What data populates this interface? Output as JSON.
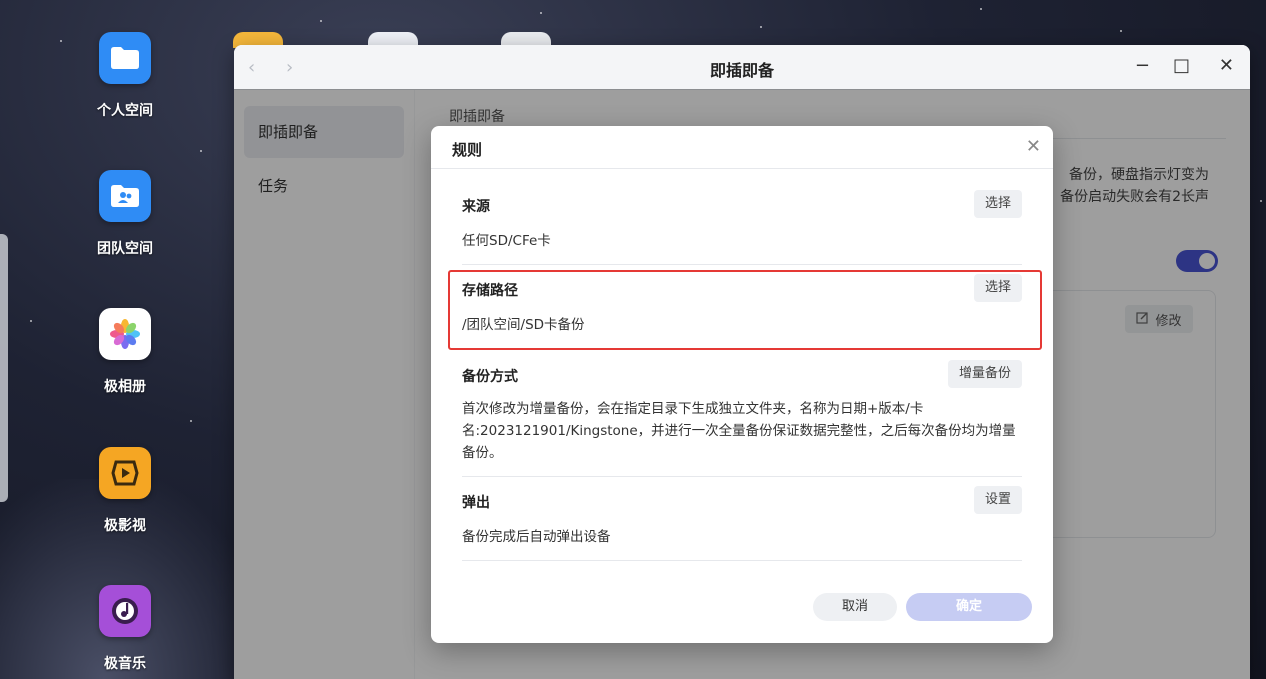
{
  "desktop": {
    "icons": [
      {
        "label": "个人空间",
        "icon": "folder-icon",
        "color": "#2f8cf5"
      },
      {
        "label": "团队空间",
        "icon": "team-folder-icon",
        "color": "#2f8cf5"
      },
      {
        "label": "极相册",
        "icon": "photos-icon",
        "color": "#ffffff"
      },
      {
        "label": "极影视",
        "icon": "video-icon",
        "color": "#f5a623"
      },
      {
        "label": "极音乐",
        "icon": "music-icon",
        "color": "#a54fd8"
      }
    ]
  },
  "window": {
    "title": "即插即备",
    "back_icon": "‹",
    "forward_icon": "›",
    "minimize_icon": "−",
    "maximize_icon": "□",
    "close_icon": "✕",
    "sidebar": {
      "items": [
        {
          "label": "即插即备"
        },
        {
          "label": "任务"
        }
      ]
    },
    "content": {
      "title": "即插即备",
      "desc_line1": "备份，硬盘指示灯变为",
      "desc_line2": "备份启动失败会有2长声",
      "modify_label": "修改",
      "toggle_on": true
    }
  },
  "dialog": {
    "title": "规则",
    "close_icon": "✕",
    "sections": [
      {
        "heading": "来源",
        "value": "任何SD/CFe卡",
        "button": "选择"
      },
      {
        "heading": "存储路径",
        "value": "/团队空间/SD卡备份",
        "button": "选择"
      },
      {
        "heading": "备份方式",
        "value": "首次修改为增量备份，会在指定目录下生成独立文件夹，名称为日期+版本/卡名:2023121901/Kingstone，并进行一次全量备份保证数据完整性，之后每次备份均为增量备份。",
        "button": "增量备份"
      },
      {
        "heading": "弹出",
        "value": "备份完成后自动弹出设备",
        "button": "设置"
      }
    ],
    "cancel_label": "取消",
    "ok_label": "确定"
  },
  "colors": {
    "accent": "#4a55d6",
    "highlight": "#e53935",
    "ok_disabled": "#c6ccf3"
  }
}
